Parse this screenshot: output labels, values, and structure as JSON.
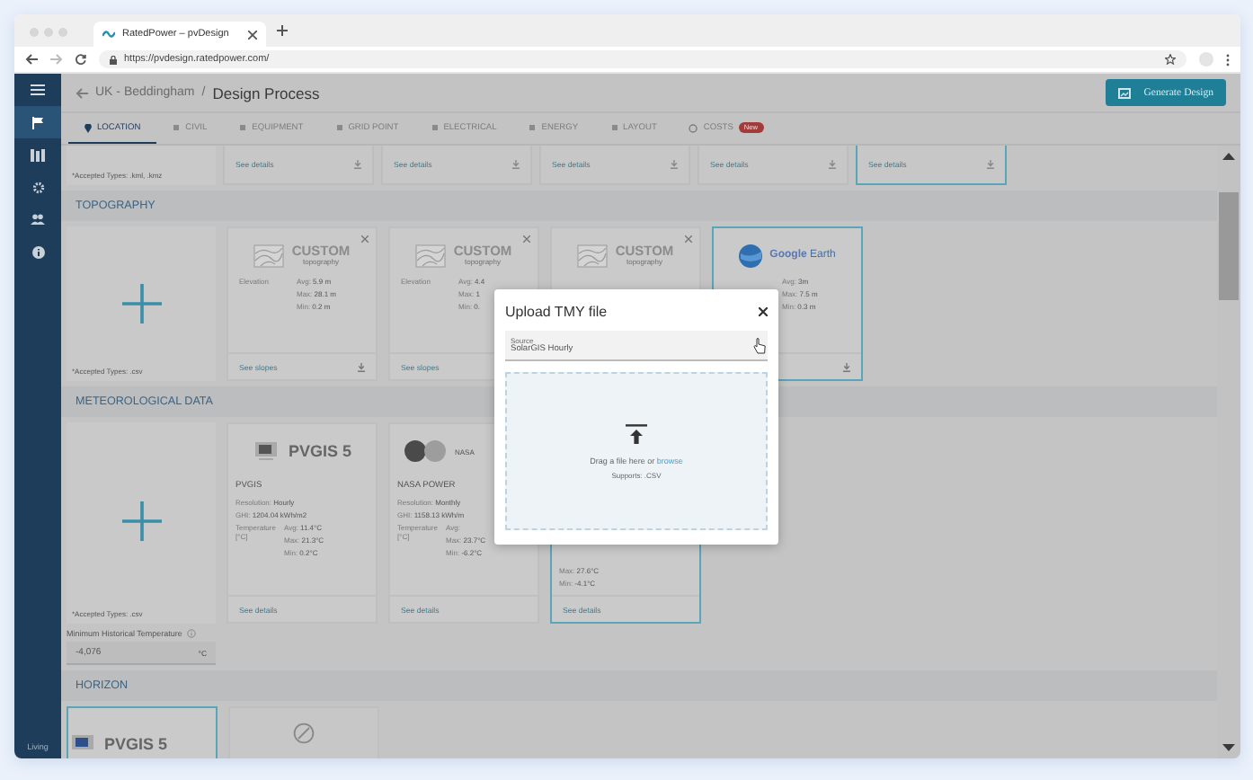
{
  "browser": {
    "tab_title": "RatedPower – pvDesign",
    "url": "https://pvdesign.ratedpower.com/"
  },
  "sidebar": {
    "items": [
      {
        "kind": "menu",
        "selected": false
      },
      {
        "kind": "flag",
        "selected": true
      },
      {
        "kind": "library",
        "selected": false
      },
      {
        "kind": "gear",
        "selected": false
      },
      {
        "kind": "users",
        "selected": false
      },
      {
        "kind": "info",
        "selected": false
      }
    ],
    "footer": "Living"
  },
  "header": {
    "breadcrumb": "UK - Beddingham",
    "separator": "/",
    "title": "Design Process",
    "action": "Generate Design"
  },
  "tabs": [
    {
      "label": "LOCATION",
      "selected": true
    },
    {
      "label": "CIVIL",
      "selected": false
    },
    {
      "label": "EQUIPMENT",
      "selected": false
    },
    {
      "label": "GRID POINT",
      "selected": false
    },
    {
      "label": "ELECTRICAL",
      "selected": false
    },
    {
      "label": "ENERGY",
      "selected": false
    },
    {
      "label": "LAYOUT",
      "selected": false
    },
    {
      "label": "COSTS",
      "selected": false,
      "badge": "New"
    }
  ],
  "top_strip": {
    "accepted": "*Accepted Types: .kml, .kmz",
    "cards": [
      {
        "link": "See details",
        "selected": false
      },
      {
        "link": "See details",
        "selected": false
      },
      {
        "link": "See details",
        "selected": false
      },
      {
        "link": "See details",
        "selected": false
      },
      {
        "link": "See details",
        "selected": true
      }
    ]
  },
  "topography": {
    "title": "TOPOGRAPHY",
    "accepted": "*Accepted Types: .csv",
    "cards": [
      {
        "kind": "custom",
        "logo": "CUSTOM",
        "logo_sub": "topography",
        "removable": true,
        "selected": false,
        "stat_label": "Elevation",
        "values": [
          "Avg: **5.9 m**",
          "Max: **28.1 m**",
          "Min: **0.2 m**"
        ],
        "link": "See slopes",
        "download": true
      },
      {
        "kind": "custom",
        "logo": "CUSTOM",
        "logo_sub": "topography",
        "removable": true,
        "selected": false,
        "stat_label": "Elevation",
        "values": [
          "Avg: **4.4**",
          "Max: **1**",
          "Min: **0.**"
        ],
        "link": "See slopes",
        "download": false
      },
      {
        "kind": "custom",
        "logo": "CUSTOM",
        "logo_sub": "topography",
        "removable": true,
        "selected": false
      },
      {
        "kind": "google_earth",
        "logo": "Google",
        "logo_accent": "Earth",
        "selected": true,
        "values": [
          "Avg: **3m**",
          "Max: **7.5 m**",
          "Min: **0.3 m**"
        ],
        "download": true
      }
    ]
  },
  "meteorological": {
    "title": "METEOROLOGICAL DATA",
    "accepted": "*Accepted Types: .csv",
    "cards": [
      {
        "kind": "pvgis",
        "logo": "PVGIS 5",
        "name": "PVGIS",
        "lines": [
          "Resolution: **Hourly**",
          "GHI: **1204.04 kWh/m2**"
        ],
        "temp_label": "Temperature [°C]",
        "temps": [
          "Avg: **11.4°C**",
          "Max: **21.3°C**",
          "Min: **0.2°C**"
        ],
        "link": "See details",
        "selected": false
      },
      {
        "kind": "nasa",
        "logo": "NASA",
        "name": "NASA POWER",
        "lines": [
          "Resolution: **Monthly**",
          "GHI: **1158.13 kWh/m**"
        ],
        "temp_label": "Temperature [°C]",
        "temps": [
          "Avg:",
          "Max: **23.7°C**",
          "Min: **-6.2°C**"
        ],
        "link": "See details",
        "selected": false
      },
      {
        "kind": "partial",
        "temps": [
          "Max: **27.6°C**",
          "Min: **-4.1°C**"
        ],
        "link": "See details",
        "selected": true
      }
    ],
    "min_temp": {
      "label": "Minimum Historical Temperature",
      "value": "-4,076",
      "unit": "°C"
    }
  },
  "horizon": {
    "title": "HORIZON",
    "cards": [
      {
        "kind": "pvgis",
        "logo": "PVGIS 5",
        "selected": true
      },
      {
        "kind": "none",
        "selected": false
      }
    ]
  },
  "modal": {
    "title": "Upload TMY file",
    "source_label": "Source",
    "source_value": "SolarGIS Hourly",
    "drop_text": "Drag a file here or",
    "browse": "browse",
    "supports": "Supports: .CSV"
  }
}
